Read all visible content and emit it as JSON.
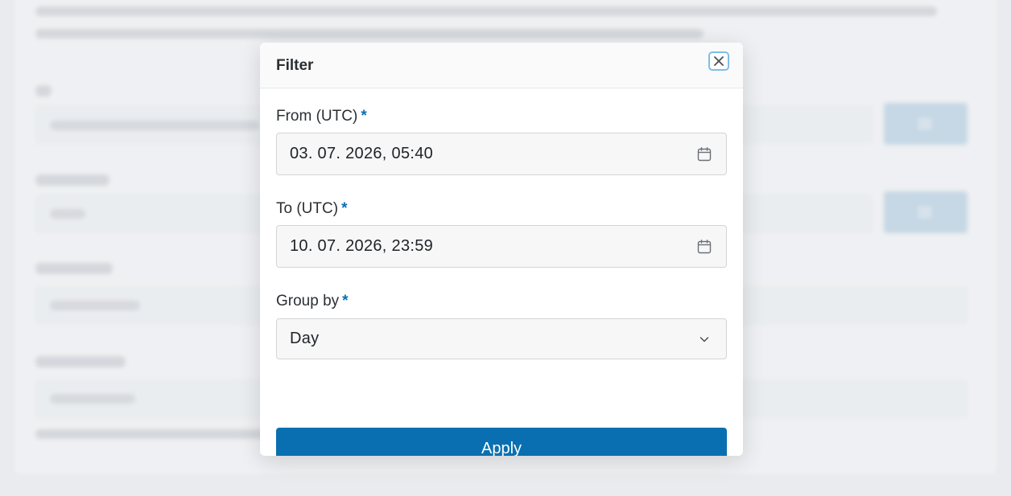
{
  "modal": {
    "title": "Filter",
    "from_label": "From (UTC)",
    "from_value": "03. 07. 2026, 05:40",
    "to_label": "To (UTC)",
    "to_value": "10. 07. 2026, 23:59",
    "group_label": "Group by",
    "group_value": "Day",
    "required_mark": "*",
    "apply_label": "Apply",
    "icons": {
      "close": "close-icon",
      "calendar": "calendar-icon",
      "dropdown": "chevron-down-icon"
    }
  },
  "colors": {
    "accent": "#0a6fb0",
    "required": "#0a6fb3",
    "focus_ring": "#7fbde8"
  }
}
